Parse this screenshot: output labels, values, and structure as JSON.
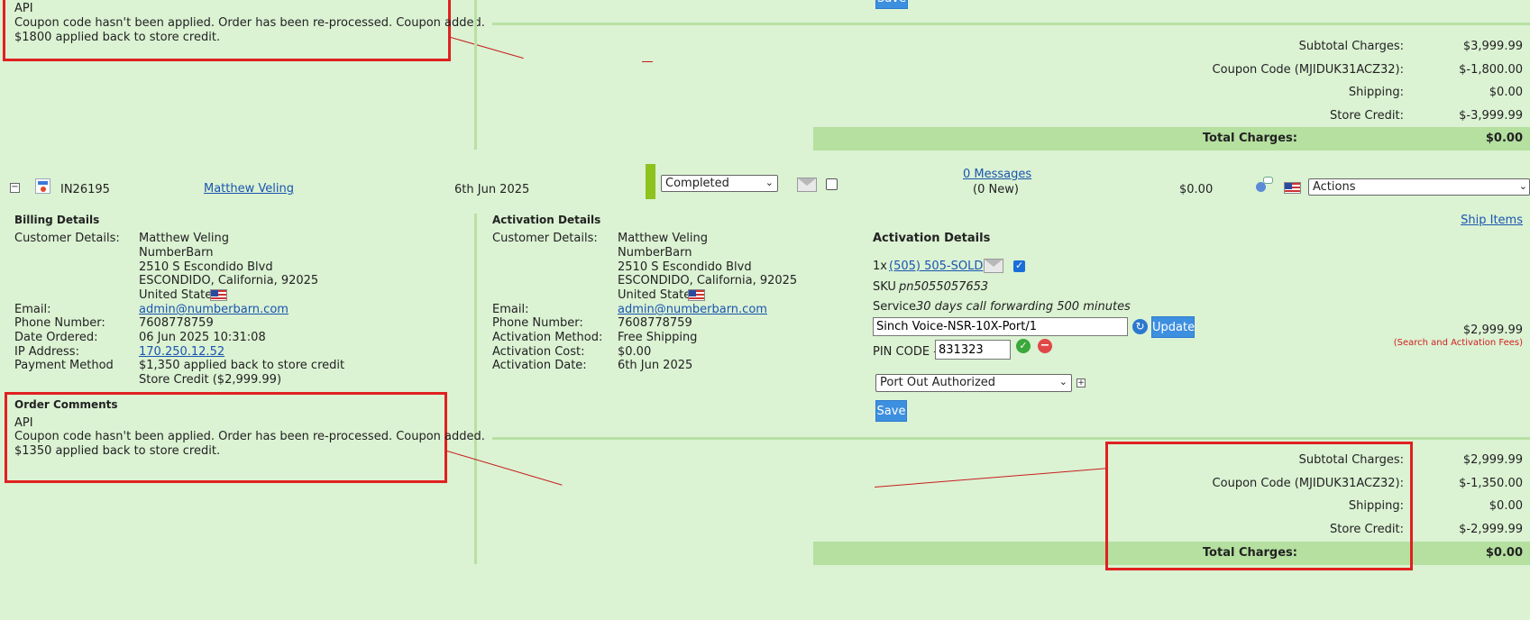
{
  "top_section": {
    "comment_source": "API",
    "comment_line1": "Coupon code hasn't been applied. Order has been re-processed. Coupon added.",
    "comment_line2": "$1800 applied back to store credit.",
    "save_label": "Save",
    "totals": {
      "subtotal_label": "Subtotal Charges:",
      "subtotal_value": "$3,999.99",
      "coupon_label": "Coupon Code (MJIDUK31ACZ32):",
      "coupon_value": "$-1,800.00",
      "shipping_label": "Shipping:",
      "shipping_value": "$0.00",
      "store_credit_label": "Store Credit:",
      "store_credit_value": "$-3,999.99",
      "total_label": "Total Charges:",
      "total_value": "$0.00"
    }
  },
  "order_row": {
    "toggle": "−",
    "order_id": "IN26195",
    "customer_name": "Matthew Veling",
    "date": "6th Jun 2025",
    "status": "Completed",
    "messages_link": "0 Messages",
    "messages_new": "(0 New)",
    "amount": "$0.00",
    "actions": "Actions"
  },
  "billing": {
    "heading": "Billing Details",
    "customer_details_label": "Customer Details:",
    "name": "Matthew Veling",
    "company": "NumberBarn",
    "street": "2510 S Escondido Blvd",
    "city": "ESCONDIDO, California, 92025",
    "country": "United States",
    "email_label": "Email:",
    "email": "admin@numberbarn.com",
    "phone_label": "Phone Number:",
    "phone": "7608778759",
    "date_ordered_label": "Date Ordered:",
    "date_ordered": "06 Jun 2025 10:31:08",
    "ip_label": "IP Address:",
    "ip": "170.250.12.52",
    "payment_label": "Payment Method",
    "payment_line1": "$1,350 applied back to store credit",
    "payment_line2": "Store Credit ($2,999.99)"
  },
  "order_comments": {
    "heading": "Order Comments",
    "source": "API",
    "line1": "Coupon code hasn't been applied. Order has been re-processed. Coupon added.",
    "line2": "$1350 applied back to store credit."
  },
  "activation": {
    "heading": "Activation Details",
    "customer_details_label": "Customer Details:",
    "name": "Matthew Veling",
    "company": "NumberBarn",
    "street": "2510 S Escondido Blvd",
    "city": "ESCONDIDO, California, 92025",
    "country": "United States",
    "email_label": "Email:",
    "email": "admin@numberbarn.com",
    "phone_label": "Phone Number:",
    "phone": "7608778759",
    "method_label": "Activation Method:",
    "method": "Free Shipping",
    "cost_label": "Activation Cost:",
    "cost": "$0.00",
    "date_label": "Activation Date:",
    "date": "6th Jun 2025"
  },
  "activation_item": {
    "heading": "Activation Details",
    "qty": "1x",
    "number_link": "(505) 505-SOLD",
    "sku_label": "SKU",
    "sku": "pn5055057653",
    "service_label": "Service",
    "service": "30 days call forwarding 500 minutes",
    "carrier_value": "Sinch Voice-NSR-10X-Port/1",
    "update_label": "Update",
    "pin_label": "PIN CODE -",
    "pin_value": "831323",
    "port_status": "Port Out Authorized",
    "plus": "+",
    "save_label": "Save",
    "ship_items": "Ship Items",
    "price": "$2,999.99",
    "fee_note": "(Search and Activation Fees)"
  },
  "bottom_totals": {
    "subtotal_label": "Subtotal Charges:",
    "subtotal_value": "$2,999.99",
    "coupon_label": "Coupon Code (MJIDUK31ACZ32):",
    "coupon_value": "$-1,350.00",
    "shipping_label": "Shipping:",
    "shipping_value": "$0.00",
    "store_credit_label": "Store Credit:",
    "store_credit_value": "$-2,999.99",
    "total_label": "Total Charges:",
    "total_value": "$0.00"
  },
  "colors": {
    "background": "#dbf2d3",
    "highlight_red": "#e02020",
    "total_bar": "#b5e0a0",
    "status_green": "#8dc21f",
    "link_blue": "#1a55b0",
    "button_blue": "#3d8fe0",
    "fee_red": "#d02020"
  }
}
